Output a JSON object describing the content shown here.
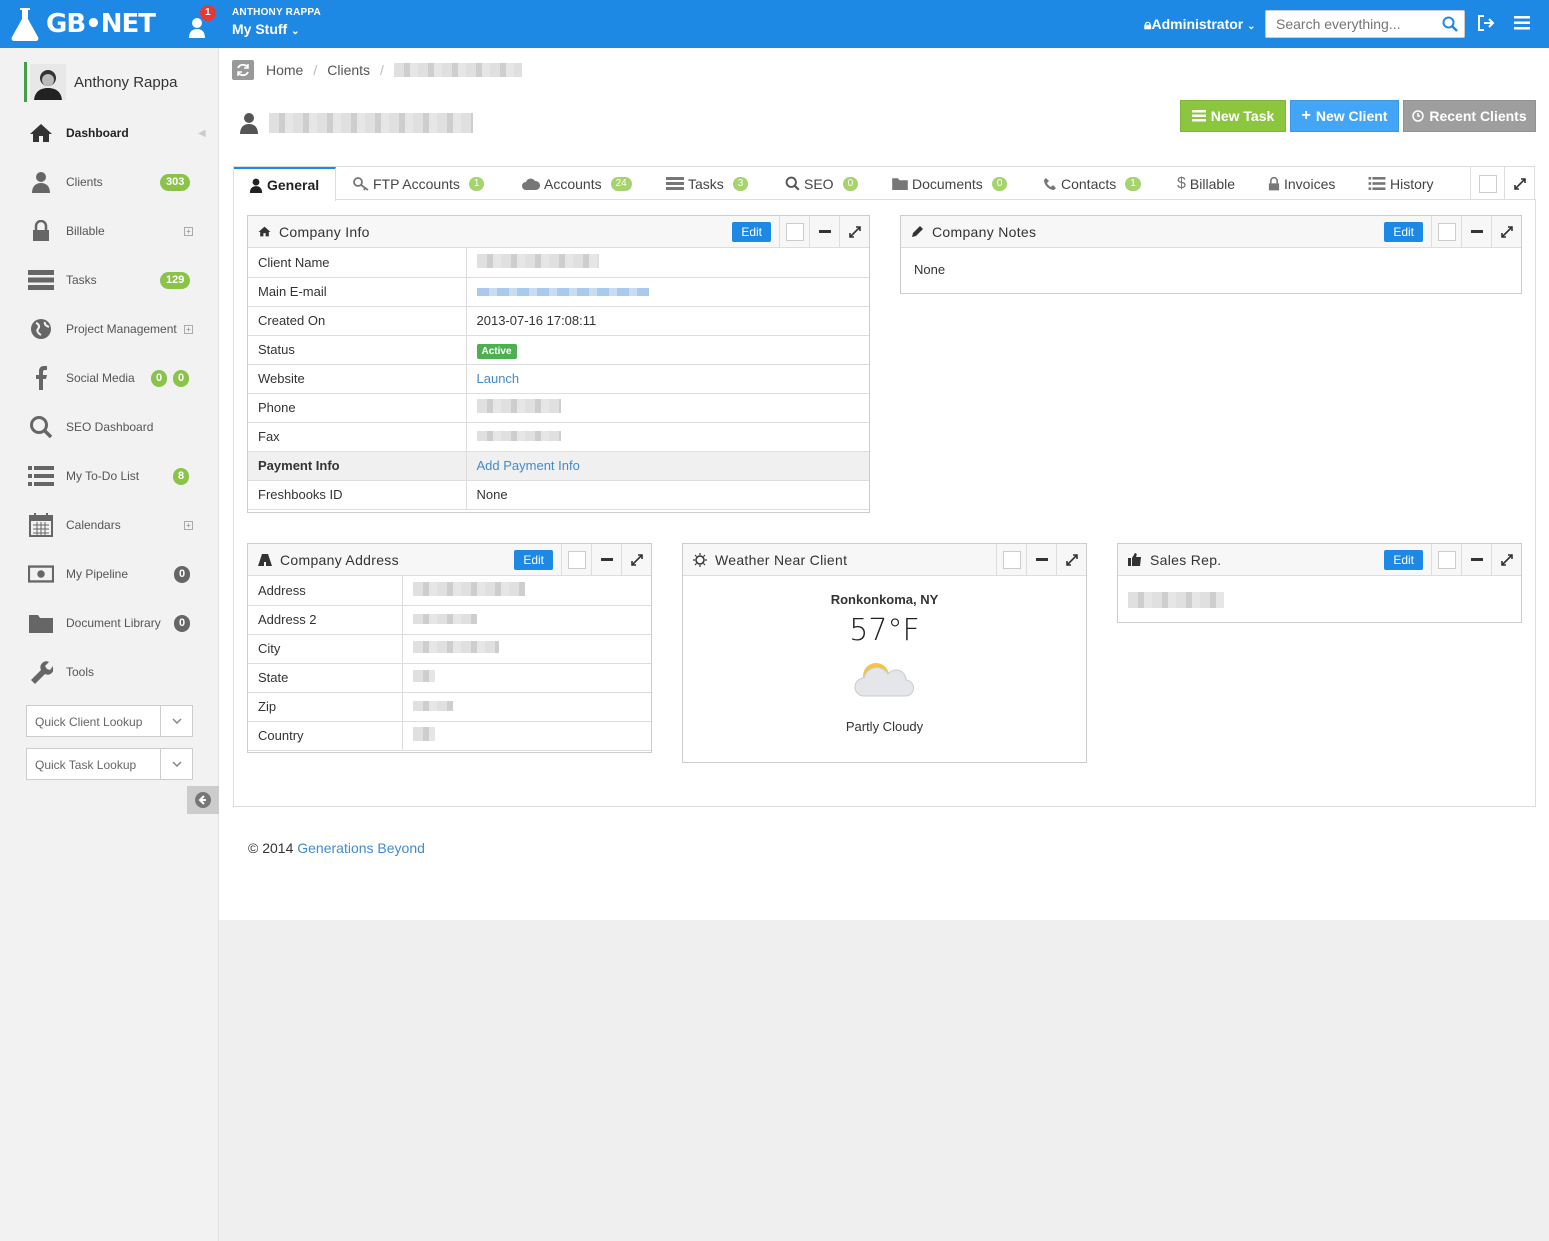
{
  "app": {
    "logo": "GB•NET",
    "notifications": "1"
  },
  "user": {
    "name_caps": "ANTHONY RAPPA",
    "menu_label": "My Stuff",
    "role": "Administrator"
  },
  "search": {
    "placeholder": "Search everything..."
  },
  "sidebar": {
    "profile_name": "Anthony Rappa",
    "items": [
      {
        "label": "Dashboard",
        "icon": "home-icon"
      },
      {
        "label": "Clients",
        "icon": "user-icon",
        "badge": "303"
      },
      {
        "label": "Billable",
        "icon": "lock-icon"
      },
      {
        "label": "Tasks",
        "icon": "tasks-icon",
        "badge": "129"
      },
      {
        "label": "Project Management",
        "icon": "globe-icon"
      },
      {
        "label": "Social Media",
        "icon": "facebook-icon",
        "badges": [
          "0",
          "0"
        ]
      },
      {
        "label": "SEO Dashboard",
        "icon": "search-icon"
      },
      {
        "label": "My To-Do List",
        "icon": "list-icon",
        "badge": "8"
      },
      {
        "label": "Calendars",
        "icon": "calendar-icon"
      },
      {
        "label": "My Pipeline",
        "icon": "money-icon",
        "badge": "0"
      },
      {
        "label": "Document Library",
        "icon": "folder-icon",
        "badge": "0"
      },
      {
        "label": "Tools",
        "icon": "wrench-icon"
      }
    ],
    "quick_client": "Quick Client Lookup",
    "quick_task": "Quick Task Lookup"
  },
  "breadcrumb": {
    "home": "Home",
    "clients": "Clients"
  },
  "actions": {
    "new_task": "New Task",
    "new_client": "New Client",
    "recent_clients": "Recent Clients"
  },
  "tabs": [
    {
      "label": "General"
    },
    {
      "label": "FTP Accounts",
      "badge": "1"
    },
    {
      "label": "Accounts",
      "badge": "24"
    },
    {
      "label": "Tasks",
      "badge": "3"
    },
    {
      "label": "SEO",
      "badge": "0"
    },
    {
      "label": "Documents",
      "badge": "0"
    },
    {
      "label": "Contacts",
      "badge": "1"
    },
    {
      "label": "Billable"
    },
    {
      "label": "Invoices"
    },
    {
      "label": "History"
    }
  ],
  "company_info": {
    "title": "Company Info",
    "edit": "Edit",
    "rows": {
      "client_name": "Client Name",
      "main_email": "Main E-mail",
      "created_on": "Created On",
      "created_on_value": "2013-07-16 17:08:11",
      "status": "Status",
      "status_value": "Active",
      "website": "Website",
      "website_value": "Launch",
      "phone": "Phone",
      "fax": "Fax",
      "payment_info": "Payment Info",
      "payment_info_value": "Add Payment Info",
      "freshbooks_id": "Freshbooks ID",
      "freshbooks_id_value": "None"
    }
  },
  "company_notes": {
    "title": "Company Notes",
    "edit": "Edit",
    "body": "None"
  },
  "company_address": {
    "title": "Company Address",
    "edit": "Edit",
    "rows": [
      "Address",
      "Address 2",
      "City",
      "State",
      "Zip",
      "Country"
    ]
  },
  "weather": {
    "title": "Weather Near Client",
    "location": "Ronkonkoma, NY",
    "temp": "57°F",
    "condition": "Partly Cloudy"
  },
  "sales_rep": {
    "title": "Sales Rep.",
    "edit": "Edit"
  },
  "footer": {
    "copy": "© 2014",
    "company": "Generations Beyond"
  },
  "colors": {
    "topbar": "#1e88e5",
    "green": "#8cc63f",
    "blue_btn": "#42a5f5",
    "gray_btn": "#9e9e9e",
    "badge_green": "#8bc34a"
  }
}
